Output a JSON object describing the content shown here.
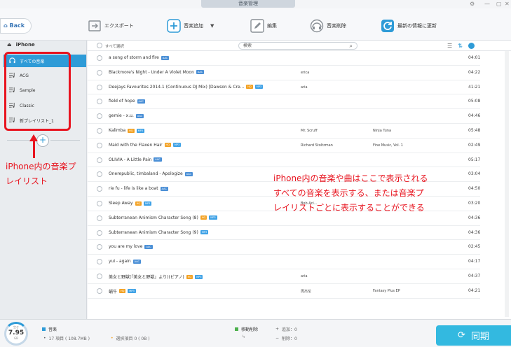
{
  "window": {
    "title": "音楽管理"
  },
  "toolbar": {
    "back_label": "Back",
    "export_label": "エクスポート",
    "add_label": "音楽追加",
    "edit_label": "編集",
    "delete_label": "音楽削除",
    "refresh_label": "最新の情報に更新"
  },
  "sidebar": {
    "device_name": "iPhone",
    "items": [
      {
        "label": "すべての音楽"
      },
      {
        "label": "ACG"
      },
      {
        "label": "Sample"
      },
      {
        "label": "Classic"
      },
      {
        "label": "新プレイリスト_1"
      }
    ]
  },
  "list": {
    "select_all_label": "すべて選択",
    "search_placeholder": "検索",
    "rows": [
      {
        "title": "a song of storm and fire",
        "tags": [
          "AAC"
        ],
        "artist": "",
        "album": "",
        "duration": "04:01"
      },
      {
        "title": "Blackmore's Night - Under A Violet Moon",
        "tags": [
          "AAC"
        ],
        "artist": "erica",
        "album": "",
        "duration": "04:22"
      },
      {
        "title": "Deejays Favourites 2014.1 (Continuous DJ Mix) [Dawson & Cre...",
        "tags": [
          "HQ",
          "MP3"
        ],
        "artist": "aria",
        "album": "",
        "duration": "41:21"
      },
      {
        "title": "field of hope",
        "tags": [
          "AAC"
        ],
        "artist": "",
        "album": "",
        "duration": "05:08"
      },
      {
        "title": "gemie - x.u.",
        "tags": [
          "AAC"
        ],
        "artist": "",
        "album": "",
        "duration": "04:46"
      },
      {
        "title": "Kalimba",
        "tags": [
          "HQ",
          "MP3"
        ],
        "artist": "Mr. Scruff",
        "album": "Ninja Tuna",
        "duration": "05:48"
      },
      {
        "title": "Maid with the Flaxen Hair",
        "tags": [
          "HQ",
          "MP3"
        ],
        "artist": "Richard Stoltzman",
        "album": "Fine Music, Vol. 1",
        "duration": "02:49"
      },
      {
        "title": "OLIVIA - A Little Pain",
        "tags": [
          "AAC"
        ],
        "artist": "",
        "album": "",
        "duration": "05:17"
      },
      {
        "title": "Onerepublic, timbaland - Apologize",
        "tags": [
          "AAC"
        ],
        "artist": "",
        "album": "",
        "duration": "03:04"
      },
      {
        "title": "rie fu - life is like a boat",
        "tags": [
          "AAC"
        ],
        "artist": "",
        "album": "",
        "duration": "04:50"
      },
      {
        "title": "Sleep Away",
        "tags": [
          "HQ",
          "MP3"
        ],
        "artist": "Bob Aci...",
        "album": "",
        "duration": "03:20"
      },
      {
        "title": "Subterranean Animism Character Song (8)",
        "tags": [
          "HQ",
          "MP3"
        ],
        "artist": "",
        "album": "",
        "duration": "04:36"
      },
      {
        "title": "Subterranean Animism Character Song (9)",
        "tags": [
          "MP3"
        ],
        "artist": "",
        "album": "",
        "duration": "04:36"
      },
      {
        "title": "you are my love",
        "tags": [
          "AAC"
        ],
        "artist": "",
        "album": "",
        "duration": "02:45"
      },
      {
        "title": "yui - again",
        "tags": [
          "AAC"
        ],
        "artist": "",
        "album": "",
        "duration": "04:17"
      },
      {
        "title": "美女と野獣(『美女と野獣』より)(ピアノ)",
        "tags": [
          "HQ",
          "MP3"
        ],
        "artist": "aria",
        "album": "",
        "duration": "04:37"
      },
      {
        "title": "蜗牛",
        "tags": [
          "HQ",
          "MP3"
        ],
        "artist": "周杰伦",
        "album": "Fantasy Plus EP",
        "duration": "04:21"
      }
    ]
  },
  "annotations": {
    "left_line1": "iPhone内の音楽プ",
    "left_line2": "レイリスト",
    "right_line1": "iPhone内の音楽や曲はここで表示される",
    "right_line2": "すべての音楽を表示する、または音楽プ",
    "right_line3": "レイリストごとに表示することができる"
  },
  "footer": {
    "capacity_label": "空き",
    "capacity_value": "7.95",
    "capacity_unit": "GB",
    "category_label": "音楽",
    "items_count": "17 項目 ( 108.7MB )",
    "selected_count": "選択項目 0 ( 0B )",
    "pending_delete_label": "移動削除",
    "add_count": "追加：0",
    "delete_count": "削除：0",
    "sync_label": "同期"
  },
  "colors": {
    "accent": "#2e9bd7",
    "annotation": "#e8141f",
    "sync": "#33b9e0"
  }
}
